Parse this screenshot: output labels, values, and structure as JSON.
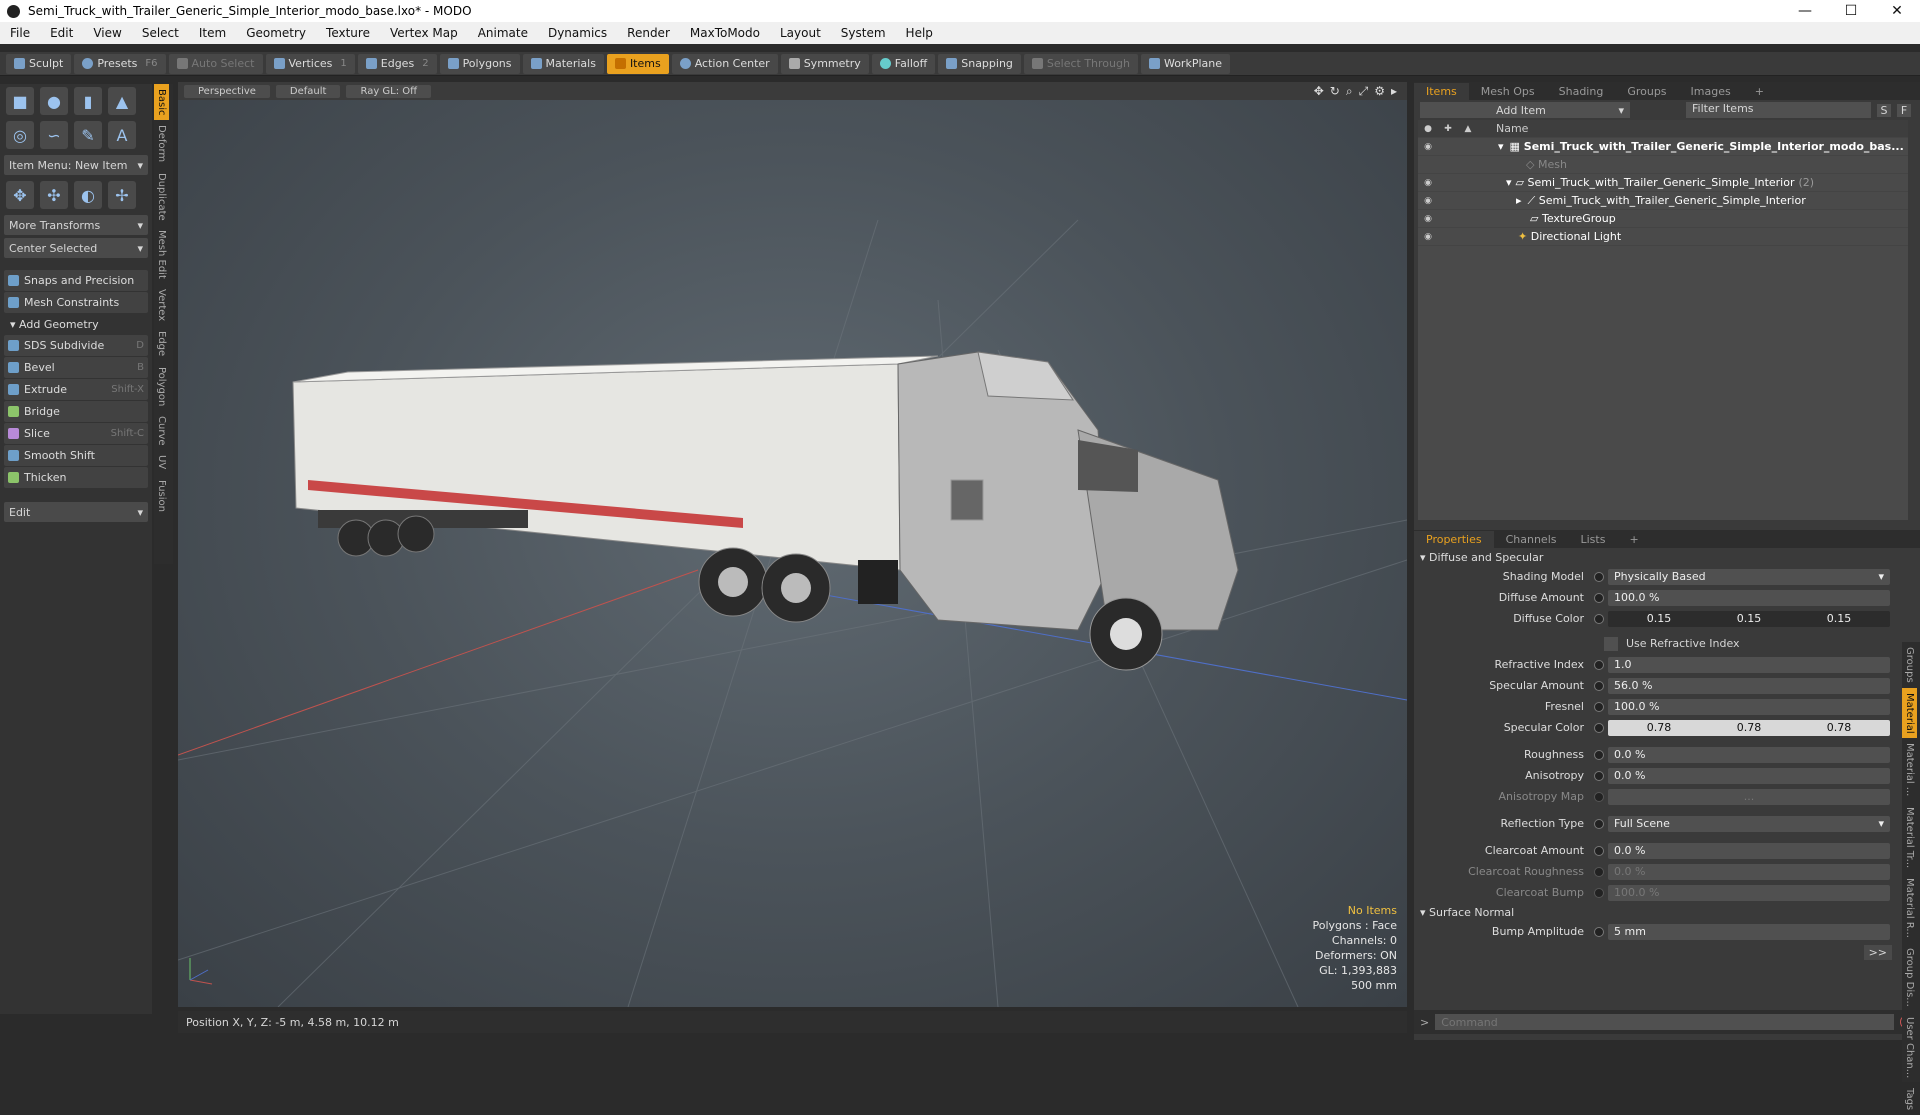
{
  "window": {
    "title": "Semi_Truck_with_Trailer_Generic_Simple_Interior_modo_base.lxo* - MODO",
    "min": "—",
    "max": "☐",
    "close": "✕"
  },
  "menu": [
    "File",
    "Edit",
    "View",
    "Select",
    "Item",
    "Geometry",
    "Texture",
    "Vertex Map",
    "Animate",
    "Dynamics",
    "Render",
    "MaxToModo",
    "Layout",
    "System",
    "Help"
  ],
  "toolbar": {
    "sculpt": "Sculpt",
    "presets": "Presets",
    "presets_key": "F6",
    "auto_select": "Auto Select",
    "vertices": "Vertices",
    "vertices_n": "1",
    "edges": "Edges",
    "edges_n": "2",
    "polygons": "Polygons",
    "materials": "Materials",
    "items": "Items",
    "action_center": "Action Center",
    "symmetry": "Symmetry",
    "falloff": "Falloff",
    "snapping": "Snapping",
    "select_through": "Select Through",
    "workplane": "WorkPlane"
  },
  "left": {
    "item_menu": "Item Menu: New Item",
    "more_transforms": "More Transforms",
    "center_selected": "Center Selected",
    "snaps": "Snaps and Precision",
    "mesh_constraints": "Mesh Constraints",
    "add_geometry": "Add Geometry",
    "tools": [
      {
        "label": "SDS Subdivide",
        "key": "D"
      },
      {
        "label": "Bevel",
        "key": "B"
      },
      {
        "label": "Extrude",
        "key": "Shift-X"
      },
      {
        "label": "Bridge",
        "key": ""
      },
      {
        "label": "Slice",
        "key": "Shift-C"
      },
      {
        "label": "Smooth Shift",
        "key": ""
      },
      {
        "label": "Thicken",
        "key": ""
      }
    ],
    "edit": "Edit",
    "vtabs": [
      "Basic",
      "Deform",
      "Duplicate",
      "Mesh Edit",
      "Vertex",
      "Edge",
      "Polygon",
      "Curve",
      "UV",
      "Fusion"
    ]
  },
  "viewport": {
    "perspective": "Perspective",
    "default": "Default",
    "raygl": "Ray GL: Off",
    "info": {
      "no_items": "No Items",
      "polygons": "Polygons : Face",
      "channels": "Channels: 0",
      "deformers": "Deformers: ON",
      "gl": "GL: 1,393,883",
      "scale": "500 mm"
    }
  },
  "status": {
    "position": "Position X, Y, Z:  -5 m, 4.58 m, 10.12 m"
  },
  "items_panel": {
    "tabs": [
      "Items",
      "Mesh Ops",
      "Shading",
      "Groups",
      "Images",
      "+"
    ],
    "add_item": "Add Item",
    "filter": "Filter Items",
    "s": "S",
    "f": "F",
    "name_col": "Name",
    "rows": [
      {
        "label": "Semi_Truck_with_Trailer_Generic_Simple_Interior_modo_bas...",
        "indent": 0,
        "bold": true
      },
      {
        "label": "Mesh",
        "indent": 1,
        "dim": true
      },
      {
        "label": "Semi_Truck_with_Trailer_Generic_Simple_Interior",
        "count": "(2)",
        "indent": 1
      },
      {
        "label": "Semi_Truck_with_Trailer_Generic_Simple_Interior",
        "indent": 2
      },
      {
        "label": "TextureGroup",
        "indent": 2
      },
      {
        "label": "Directional Light",
        "indent": 1
      }
    ]
  },
  "properties": {
    "tabs": [
      "Properties",
      "Channels",
      "Lists",
      "+"
    ],
    "diffuse_specular": "Diffuse and Specular",
    "shading_model": {
      "label": "Shading Model",
      "value": "Physically Based"
    },
    "diffuse_amount": {
      "label": "Diffuse Amount",
      "value": "100.0 %"
    },
    "diffuse_color": {
      "label": "Diffuse Color",
      "r": "0.15",
      "g": "0.15",
      "b": "0.15"
    },
    "use_refractive": "Use Refractive Index",
    "refractive_index": {
      "label": "Refractive Index",
      "value": "1.0"
    },
    "specular_amount": {
      "label": "Specular Amount",
      "value": "56.0 %"
    },
    "fresnel": {
      "label": "Fresnel",
      "value": "100.0 %"
    },
    "specular_color": {
      "label": "Specular Color",
      "r": "0.78",
      "g": "0.78",
      "b": "0.78"
    },
    "roughness": {
      "label": "Roughness",
      "value": "0.0 %"
    },
    "anisotropy": {
      "label": "Anisotropy",
      "value": "0.0 %"
    },
    "anisotropy_map": {
      "label": "Anisotropy Map",
      "value": "..."
    },
    "reflection_type": {
      "label": "Reflection Type",
      "value": "Full Scene"
    },
    "clearcoat_amount": {
      "label": "Clearcoat Amount",
      "value": "0.0 %"
    },
    "clearcoat_roughness": {
      "label": "Clearcoat Roughness",
      "value": "0.0 %"
    },
    "clearcoat_bump": {
      "label": "Clearcoat Bump",
      "value": "100.0 %"
    },
    "surface_normal": "Surface Normal",
    "bump_amplitude": {
      "label": "Bump Amplitude",
      "value": "5 mm"
    },
    "more": ">>",
    "vtabs": [
      "Groups",
      "Material",
      "Material ...",
      "Material Tr...",
      "Material R...",
      "Group Dis...",
      "User Chan...",
      "Tags"
    ]
  },
  "command": {
    "placeholder": "Command"
  }
}
